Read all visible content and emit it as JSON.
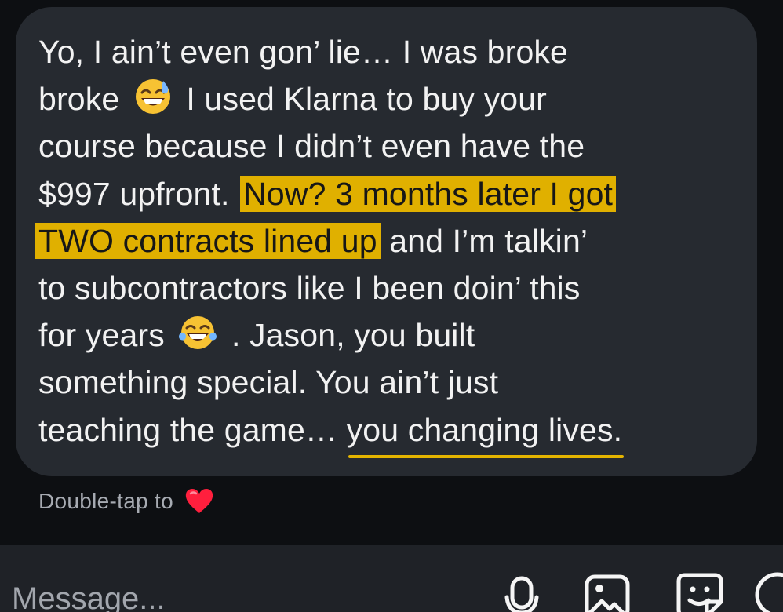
{
  "message": {
    "line1": "Yo, I ain’t even gon’ lie… I was broke",
    "line2_before_emoji": "broke",
    "line2_after_emoji": "I used Klarna to buy your",
    "line3": "course because I didn’t even have the",
    "line4_plain": "$997 upfront.",
    "line4_highlight": "Now? 3 months later I got",
    "line5_highlight": "TWO contracts lined up",
    "line5_plain": "and I’m talkin’",
    "line6": "to subcontractors like I been doin’ this",
    "line7_before_emoji": "for years",
    "line7_after_emoji": ". Jason, you built",
    "line8": "something special. You ain’t just",
    "line9_plain": "teaching the game…",
    "line9_underlined": "you changing lives."
  },
  "reaction_hint": {
    "label": "Double-tap to",
    "icon": "heart-icon",
    "color": "#ff1f3d"
  },
  "composer": {
    "placeholder": "Message...",
    "icons": [
      "microphone-icon",
      "image-icon",
      "sticker-icon",
      "add-icon"
    ]
  },
  "colors": {
    "background": "#0d0f12",
    "bubble": "#262a30",
    "text": "#f2f2f2",
    "highlight": "#e0b000",
    "underline": "#e4b400"
  }
}
